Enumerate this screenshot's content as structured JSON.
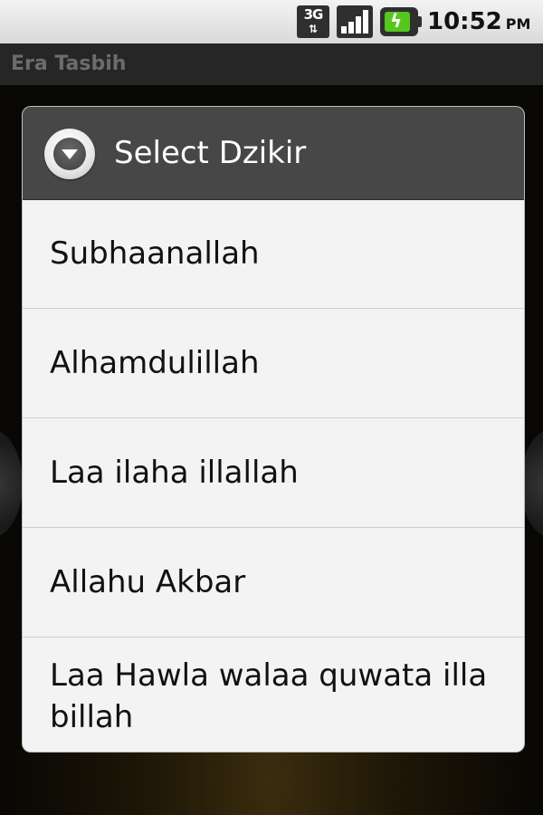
{
  "status_bar": {
    "network_type": "3G",
    "network_arrows": "⇅",
    "signal_icon": "signal-strength-icon",
    "battery_icon": "battery-charging-icon",
    "time": "10:52",
    "ampm": "PM"
  },
  "app": {
    "title": "Era Tasbih"
  },
  "dialog": {
    "icon": "dropdown-circle-icon",
    "title": "Select Dzikir",
    "options": [
      {
        "label": "Subhaanallah"
      },
      {
        "label": "Alhamdulillah"
      },
      {
        "label": "Laa ilaha illallah"
      },
      {
        "label": "Allahu Akbar"
      },
      {
        "label": "Laa Hawla walaa quwata illa billah"
      }
    ]
  },
  "colors": {
    "dialog_header": "#474747",
    "dialog_body": "#f3f3f3",
    "divider": "#cfcfcf",
    "battery_green": "#55c61e",
    "title_dimmed": "#6c6c6c"
  }
}
